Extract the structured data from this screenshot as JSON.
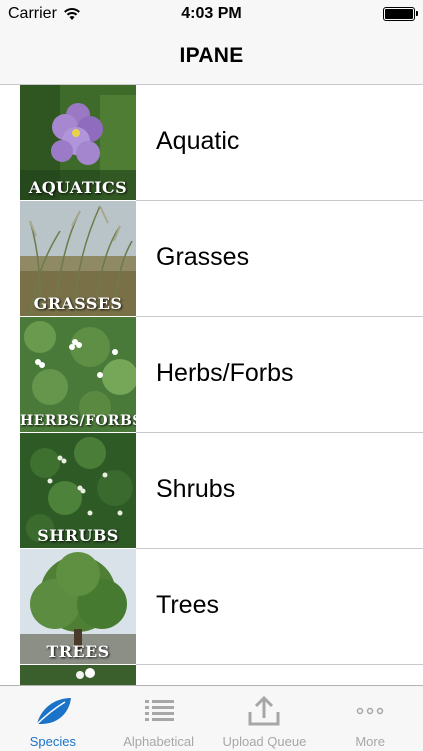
{
  "status_bar": {
    "carrier": "Carrier",
    "time": "4:03 PM",
    "wifi_icon": "wifi-icon",
    "battery_icon": "battery-icon"
  },
  "nav": {
    "title": "IPANE"
  },
  "categories": [
    {
      "label": "Aquatic",
      "thumb_caption": "Aquatics"
    },
    {
      "label": "Grasses",
      "thumb_caption": "Grasses"
    },
    {
      "label": "Herbs/Forbs",
      "thumb_caption": "Herbs/Forbs"
    },
    {
      "label": "Shrubs",
      "thumb_caption": "Shrubs"
    },
    {
      "label": "Trees",
      "thumb_caption": "Trees"
    },
    {
      "label": "",
      "thumb_caption": ""
    }
  ],
  "tabs": [
    {
      "label": "Species",
      "icon": "leaf-icon",
      "active": true
    },
    {
      "label": "Alphabetical",
      "icon": "list-icon",
      "active": false
    },
    {
      "label": "Upload Queue",
      "icon": "upload-icon",
      "active": false
    },
    {
      "label": "More",
      "icon": "more-icon",
      "active": false
    }
  ],
  "colors": {
    "accent": "#1a73c8",
    "inactive": "#a7a7a7",
    "bar": "#f7f7f7"
  }
}
